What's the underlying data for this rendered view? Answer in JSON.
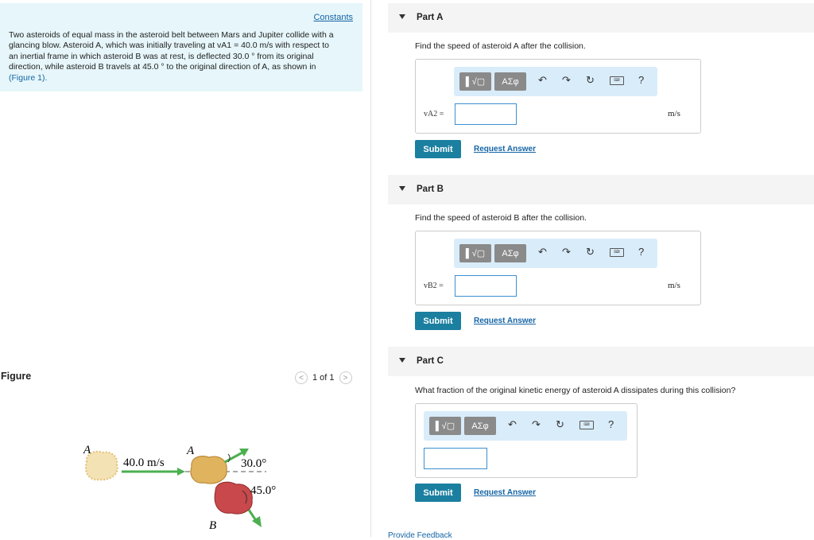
{
  "problem": {
    "constants_link": "Constants",
    "lines": [
      "Two asteroids of equal mass in the asteroid belt between Mars and Jupiter collide with a",
      "glancing blow. Asteroid A, which was initially traveling at vA1 = 40.0 m/s with respect to",
      "an inertial frame in which asteroid B was at rest, is deflected 30.0 ° from its original",
      "direction, while asteroid B travels at 45.0 ° to the original direction of A, as shown in"
    ],
    "figure_link": "(Figure 1)."
  },
  "figure": {
    "title": "Figure",
    "pager": "1 of 1",
    "labels": {
      "a_left": "A",
      "speed": "40.0 m/s",
      "a_right": "A",
      "angle_a": "30.0°",
      "angle_b": "45.0°",
      "b": "B"
    }
  },
  "toolbar": {
    "template_btn": "▌√▢",
    "greek_btn": "ΑΣφ",
    "help": "?"
  },
  "parts": [
    {
      "title": "Part A",
      "question": "Find the speed of asteroid A after the collision.",
      "var": "vA2 =",
      "unit": "m/s",
      "submit": "Submit",
      "request": "Request Answer"
    },
    {
      "title": "Part B",
      "question": "Find the speed of asteroid B after the collision.",
      "var": "vB2 =",
      "unit": "m/s",
      "submit": "Submit",
      "request": "Request Answer"
    },
    {
      "title": "Part C",
      "question": "What fraction of the original kinetic energy of asteroid A dissipates during this collision?",
      "submit": "Submit",
      "request": "Request Answer"
    }
  ],
  "footer": {
    "feedback": "Provide Feedback"
  }
}
